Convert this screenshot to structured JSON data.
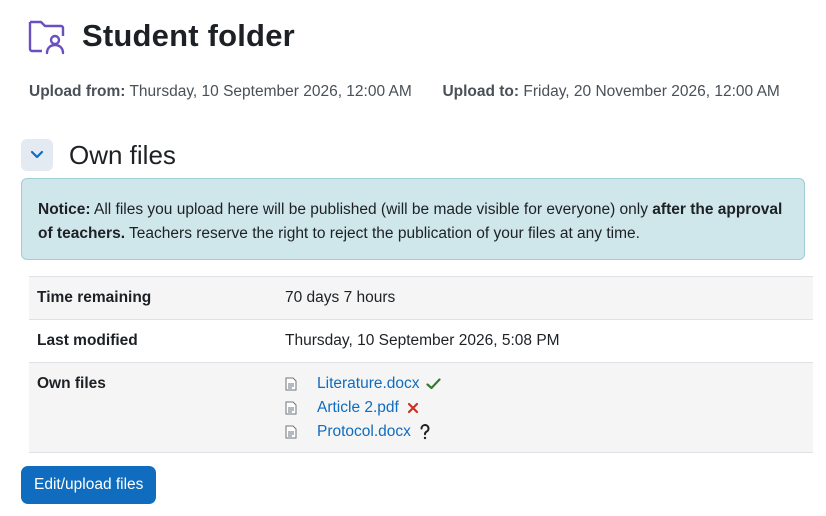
{
  "page": {
    "title": "Student folder"
  },
  "dates": {
    "from_label": "Upload from:",
    "from_value": "Thursday, 10 September 2026, 12:00 AM",
    "to_label": "Upload to:",
    "to_value": "Friday, 20 November 2026, 12:00 AM"
  },
  "section": {
    "title": "Own files"
  },
  "notice": {
    "label": "Notice:",
    "text1": "All files you upload here will be published (will be made visible for everyone) only",
    "emphasis": "after the approval of teachers.",
    "text2": "Teachers reserve the right to reject the publication of your files at any time."
  },
  "details": {
    "time_remaining_label": "Time remaining",
    "time_remaining_value": "70 days 7 hours",
    "last_modified_label": "Last modified",
    "last_modified_value": "Thursday, 10 September 2026, 5:08 PM",
    "own_files_label": "Own files"
  },
  "files": [
    {
      "name": "Literature.docx",
      "status": "approved",
      "status_icon": "check-icon"
    },
    {
      "name": "Article 2.pdf",
      "status": "rejected",
      "status_icon": "cross-icon"
    },
    {
      "name": "Protocol.docx",
      "status": "pending",
      "status_icon": "question-icon"
    }
  ],
  "colors": {
    "accent": "#0f6cbf",
    "title_icon": "#6a4fc1",
    "approved": "#357a32",
    "rejected": "#ca3120",
    "pending": "#1d2125",
    "notice_bg": "#cfe6ea"
  },
  "buttons": {
    "edit_upload": "Edit/upload files"
  }
}
